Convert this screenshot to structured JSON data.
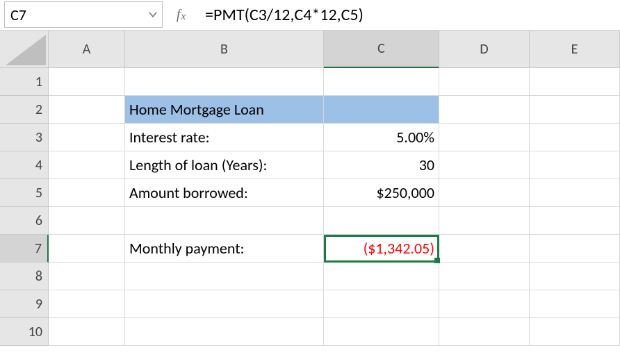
{
  "formula_bar": {
    "active_cell": "C7",
    "formula": "=PMT(C3/12,C4*12,C5)"
  },
  "columns": [
    "A",
    "B",
    "C",
    "D",
    "E"
  ],
  "rows": [
    "1",
    "2",
    "3",
    "4",
    "5",
    "6",
    "7",
    "8",
    "9",
    "10"
  ],
  "selection": {
    "col_index": 3,
    "row_index": 7
  },
  "cells": {
    "B2": "Home Mortgage Loan",
    "B3": "Interest rate:",
    "C3": "5.00%",
    "B4": "Length of loan (Years):",
    "C4": "30",
    "B5": "Amount borrowed:",
    "C5": "$250,000",
    "B7": "Monthly payment:",
    "C7": "($1,342.05)"
  },
  "chart_data": {
    "type": "table",
    "title": "Home Mortgage Loan",
    "rows": [
      {
        "label": "Interest rate:",
        "value_text": "5.00%",
        "value": 0.05
      },
      {
        "label": "Length of loan (Years):",
        "value_text": "30",
        "value": 30
      },
      {
        "label": "Amount borrowed:",
        "value_text": "$250,000",
        "value": 250000
      },
      {
        "label": "Monthly payment:",
        "value_text": "($1,342.05)",
        "value": -1342.05
      }
    ],
    "formula": "=PMT(C3/12,C4*12,C5)"
  }
}
